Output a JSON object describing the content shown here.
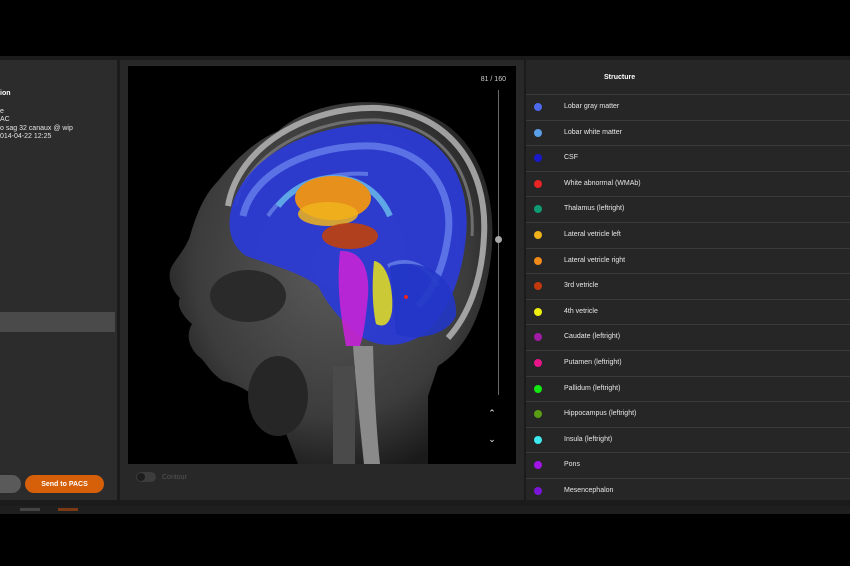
{
  "info_panel": {
    "title": "ion",
    "lines": [
      "e",
      "AC",
      "o sag 32 canaux @ wip",
      "014-04-22 12:25"
    ],
    "send_button_label": "Send to PACS"
  },
  "viewer": {
    "slice_counter": "81 / 160",
    "slice_position": 0.49,
    "up_icon": "chevron-up-icon",
    "down_icon": "chevron-down-icon",
    "contour_label": "Contour",
    "contour_on": false
  },
  "structure_list": {
    "header": "Structure",
    "items": [
      {
        "label": "Lobar gray matter",
        "color": "#4d69ee"
      },
      {
        "label": "Lobar white matter",
        "color": "#5aa0e8"
      },
      {
        "label": "CSF",
        "color": "#1a1acc"
      },
      {
        "label": "White abnormal (WMAb)",
        "color": "#e82424"
      },
      {
        "label": "Thalamus (leftright)",
        "color": "#0e9a73"
      },
      {
        "label": "Lateral vetricle left",
        "color": "#f0b21a"
      },
      {
        "label": "Lateral vetricle right",
        "color": "#f08a1a"
      },
      {
        "label": "3rd vetricle",
        "color": "#c23a0c"
      },
      {
        "label": "4th vetricle",
        "color": "#eeee10"
      },
      {
        "label": "Caudate (leftright)",
        "color": "#a01ca6"
      },
      {
        "label": "Putamen (leftright)",
        "color": "#e8148a"
      },
      {
        "label": "Pallidum (leftright)",
        "color": "#14e814"
      },
      {
        "label": "Hippocampus (leftright)",
        "color": "#5a9c14"
      },
      {
        "label": "Insula (leftright)",
        "color": "#3ee8ee"
      },
      {
        "label": "Pons",
        "color": "#a014e8"
      },
      {
        "label": "Mesencephalon",
        "color": "#7a14d8"
      }
    ]
  }
}
